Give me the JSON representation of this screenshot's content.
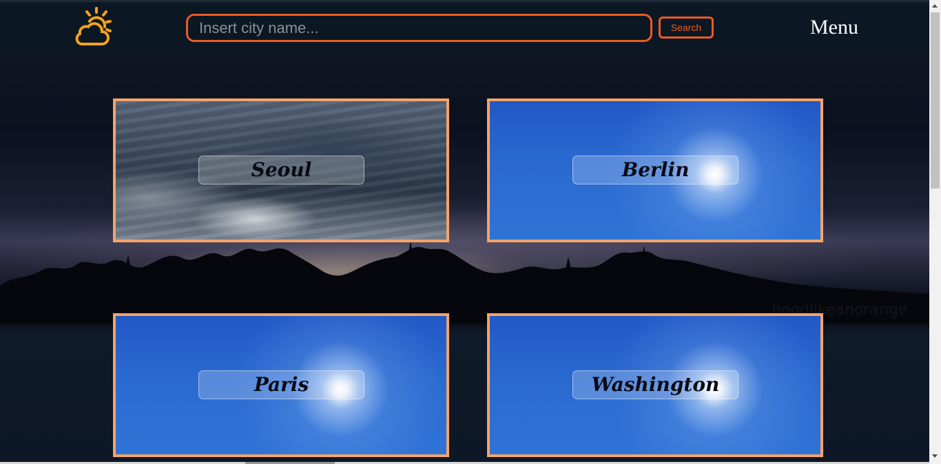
{
  "header": {
    "logo_icon": "sun-cloud-icon",
    "search_placeholder": "Insert city name...",
    "search_value": "",
    "search_button_label": "Search",
    "menu_label": "Menu"
  },
  "background": {
    "watermark_text": "hoodlikeanorange"
  },
  "cities": [
    {
      "name": "Seoul",
      "weather": "cloudy"
    },
    {
      "name": "Berlin",
      "weather": "sunny"
    },
    {
      "name": "Paris",
      "weather": "sunny"
    },
    {
      "name": "Washington",
      "weather": "sunny"
    }
  ],
  "colors": {
    "accent": "#ee5b22",
    "card_border": "#f5a36a",
    "header_bg": "#0c1724",
    "logo": "#f4a31a"
  }
}
